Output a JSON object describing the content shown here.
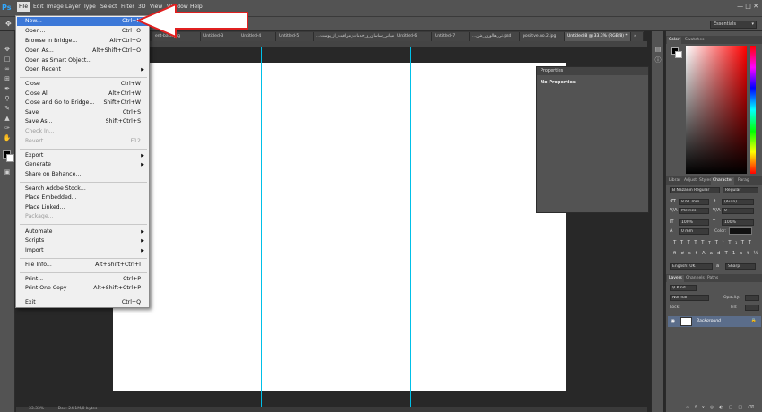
{
  "menubar": {
    "logo": "Ps",
    "items": [
      "File",
      "Edit",
      "Image",
      "Layer",
      "Type",
      "Select",
      "Filter",
      "3D",
      "View",
      "Window",
      "Help"
    ],
    "workspace": "Essentials"
  },
  "tabs": [
    {
      "label": "ent-back.jpg",
      "active": false
    },
    {
      "label": "Untitled-3",
      "active": false
    },
    {
      "label": "Untitled-4",
      "active": false
    },
    {
      "label": "Untitled-5",
      "active": false
    },
    {
      "label": "...مبانی_ساسان_و_خدمات_مراقبت_از_پوست.pdf",
      "active": false
    },
    {
      "label": "Untitled-6",
      "active": false
    },
    {
      "label": "Untitled-7",
      "active": false
    },
    {
      "label": "...تی_هالوژن_متن.psd",
      "active": false
    },
    {
      "label": "positive.no.2.jpg",
      "active": false
    },
    {
      "label": "Untitled-8 @ 33.3% (RGB/8) *",
      "active": true
    },
    {
      "label": "»",
      "active": false
    }
  ],
  "file_menu": {
    "groups": [
      [
        {
          "label": "New...",
          "shortcut": "Ctrl+N",
          "highlighted": true
        },
        {
          "label": "Open...",
          "shortcut": "Ctrl+O"
        },
        {
          "label": "Browse in Bridge...",
          "shortcut": "Alt+Ctrl+O"
        },
        {
          "label": "Open As...",
          "shortcut": "Alt+Shift+Ctrl+O"
        },
        {
          "label": "Open as Smart Object...",
          "shortcut": ""
        },
        {
          "label": "Open Recent",
          "shortcut": "",
          "submenu": true
        }
      ],
      [
        {
          "label": "Close",
          "shortcut": "Ctrl+W"
        },
        {
          "label": "Close All",
          "shortcut": "Alt+Ctrl+W"
        },
        {
          "label": "Close and Go to Bridge...",
          "shortcut": "Shift+Ctrl+W"
        },
        {
          "label": "Save",
          "shortcut": "Ctrl+S"
        },
        {
          "label": "Save As...",
          "shortcut": "Shift+Ctrl+S"
        },
        {
          "label": "Check In...",
          "shortcut": "",
          "disabled": true
        },
        {
          "label": "Revert",
          "shortcut": "F12",
          "disabled": true
        }
      ],
      [
        {
          "label": "Export",
          "shortcut": "",
          "submenu": true
        },
        {
          "label": "Generate",
          "shortcut": "",
          "submenu": true
        },
        {
          "label": "Share on Behance...",
          "shortcut": ""
        }
      ],
      [
        {
          "label": "Search Adobe Stock...",
          "shortcut": ""
        },
        {
          "label": "Place Embedded...",
          "shortcut": ""
        },
        {
          "label": "Place Linked...",
          "shortcut": ""
        },
        {
          "label": "Package...",
          "shortcut": "",
          "disabled": true
        }
      ],
      [
        {
          "label": "Automate",
          "shortcut": "",
          "submenu": true
        },
        {
          "label": "Scripts",
          "shortcut": "",
          "submenu": true
        },
        {
          "label": "Import",
          "shortcut": "",
          "submenu": true
        }
      ],
      [
        {
          "label": "File Info...",
          "shortcut": "Alt+Shift+Ctrl+I"
        }
      ],
      [
        {
          "label": "Print...",
          "shortcut": "Ctrl+P"
        },
        {
          "label": "Print One Copy",
          "shortcut": "Alt+Shift+Ctrl+P"
        }
      ],
      [
        {
          "label": "Exit",
          "shortcut": "Ctrl+Q"
        }
      ]
    ]
  },
  "properties": {
    "title": "Properties",
    "body": "No Properties"
  },
  "color_panel": {
    "tabs": [
      "Color",
      "Swatches"
    ],
    "hue_color": "#ff0000"
  },
  "character_panel": {
    "tabs": [
      "Librar",
      "Adjust",
      "Styles",
      "Character",
      "Parag"
    ],
    "font": "B Nazanin Regular",
    "style": "Regular",
    "size": "8.61 mm",
    "leading": "(Auto)",
    "kerning": "Metrics",
    "tracking": "0",
    "vscale": "100%",
    "hscale": "100%",
    "baseline": "0 mm",
    "color_label": "Color:",
    "language": "English: UK",
    "aa": "Sharp",
    "aa_short": "a"
  },
  "layers_panel": {
    "tabs": [
      "Layers",
      "Channels",
      "Paths"
    ],
    "kind": "Kind",
    "blend": "Normal",
    "opacity_label": "Opacity:",
    "lock_label": "Lock:",
    "fill_label": "Fill:",
    "layer_name": "Background"
  },
  "status": {
    "zoom": "33.33%",
    "doc": "Doc: 24.1M/0 bytes"
  }
}
